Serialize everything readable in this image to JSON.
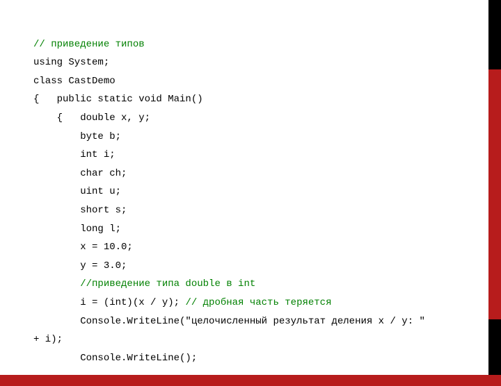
{
  "code": {
    "l1": "// приведение типов",
    "l2": "using System;",
    "l3": "class CastDemo",
    "l4": "{   public static void Main()",
    "l5": "    {   double x, y;",
    "l6": "        byte b;",
    "l7": "        int i;",
    "l8": "        char ch;",
    "l9": "        uint u;",
    "l10": "        short s;",
    "l11": "        long l;",
    "l12": "        x = 10.0;",
    "l13": "        y = 3.0;",
    "l14": "        //приведение типа double в int",
    "l15a": "        i = (int)(x / y); ",
    "l15b": "// дробная часть теряется",
    "l16": "        Console.WriteLine(\"целочисленный результат деления x / y: \"",
    "l16b": "+ i);",
    "l17": "        Console.WriteLine();"
  }
}
